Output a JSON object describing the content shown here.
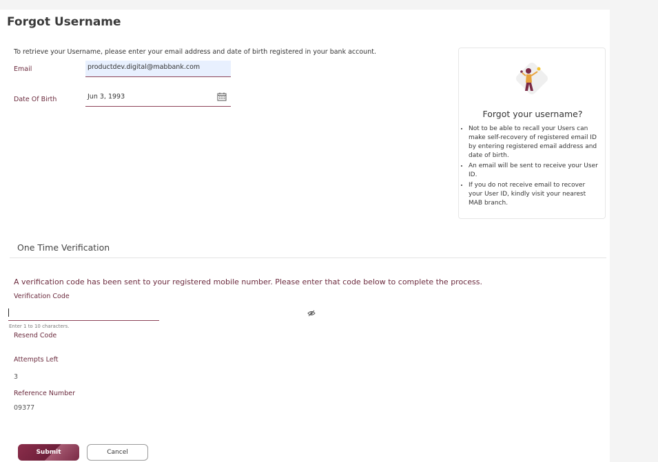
{
  "page": {
    "title": "Forgot Username",
    "intro": "To retrieve your Username, please enter your email address and date of birth registered in your bank account."
  },
  "form": {
    "email_label": "Email",
    "email_value": "productdev.digital@mabbank.com",
    "dob_label": "Date Of Birth",
    "dob_value": "Jun 3, 1993",
    "calendar_icon": "calendar-icon"
  },
  "help_panel": {
    "title": "Forgot your username?",
    "items": [
      "Not to be able to recall your Users can make self-recovery of registered email ID by entering registered email address and date of birth.",
      "An email will be sent to receive your User ID.",
      "If you do not receive email to recover your User ID, kindly visit your nearest MAB branch."
    ]
  },
  "otp": {
    "section_title": "One Time Verification",
    "message": "A verification code has been sent to your registered mobile number. Please enter that code below to complete the process.",
    "code_label": "Verification Code",
    "code_value": "",
    "hint": "Enter 1 to 10 characters.",
    "visibility_icon": "eye-off-icon",
    "resend_label": "Resend Code",
    "attempts_label": "Attempts Left",
    "attempts_value": "3",
    "reference_label": "Reference Number",
    "reference_value": "09377"
  },
  "actions": {
    "submit_label": "Submit",
    "cancel_label": "Cancel"
  },
  "colors": {
    "accent": "#6e1f3a",
    "label": "#6b2a3d",
    "autofill": "#e8f0fe"
  }
}
